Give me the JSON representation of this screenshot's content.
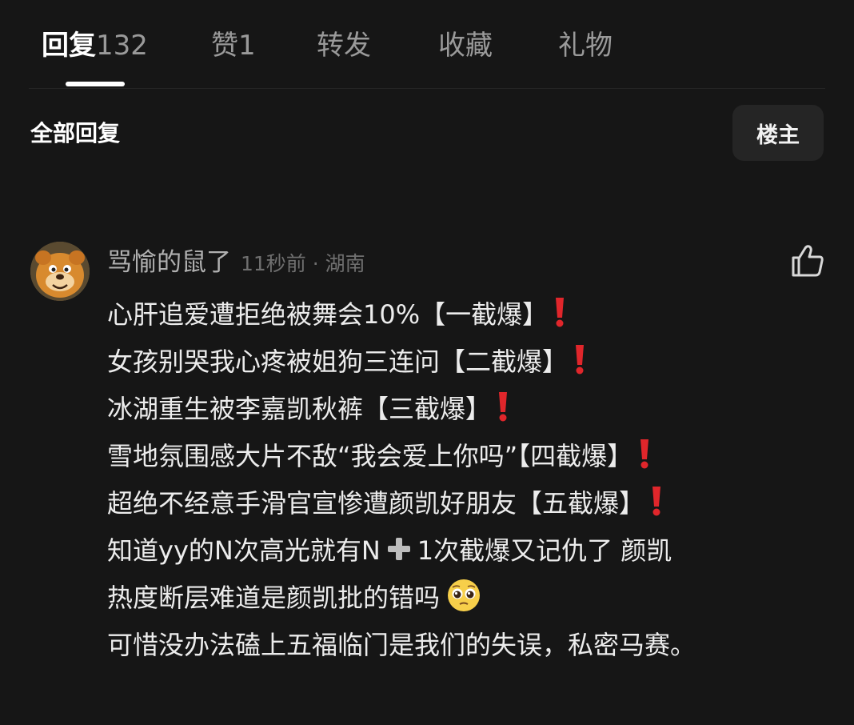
{
  "tabs": [
    {
      "name": "回复",
      "count": "132",
      "active": true
    },
    {
      "name": "赞",
      "count": "1"
    },
    {
      "name": "转发",
      "count": ""
    },
    {
      "name": "收藏",
      "count": ""
    },
    {
      "name": "礼物",
      "count": ""
    }
  ],
  "section": {
    "title": "全部回复",
    "filter_label": "楼主"
  },
  "comment": {
    "username": "骂愉的鼠了",
    "meta": "11秒前 · 湖南",
    "lines": {
      "l1": "心肝追爱遭拒绝被舞会10%【一截爆】",
      "l2": "女孩别哭我心疼被姐狗三连问【二截爆】",
      "l3": "冰湖重生被李嘉凯秋裤【三截爆】",
      "l4": "雪地氛围感大片不敌“我会爱上你吗”【四截爆】",
      "l5": "超绝不经意手滑官宣惨遭颜凯好朋友【五截爆】",
      "l6a": "知道yy的N次高光就有N",
      "l6b": "1次截爆又记仇了 颜凯",
      "l7": "热度断层难道是颜凯批的错吗",
      "l8": "可惜没办法磕上五福临门是我们的失误，私密马赛。"
    },
    "icons": {
      "exclaim": "red-exclamation-icon",
      "plus": "heavy-plus-icon",
      "emoji": "pleading-face-icon",
      "like": "thumbs-up-icon"
    }
  },
  "colors": {
    "background": "#161616",
    "accent_red": "#e0262b"
  }
}
